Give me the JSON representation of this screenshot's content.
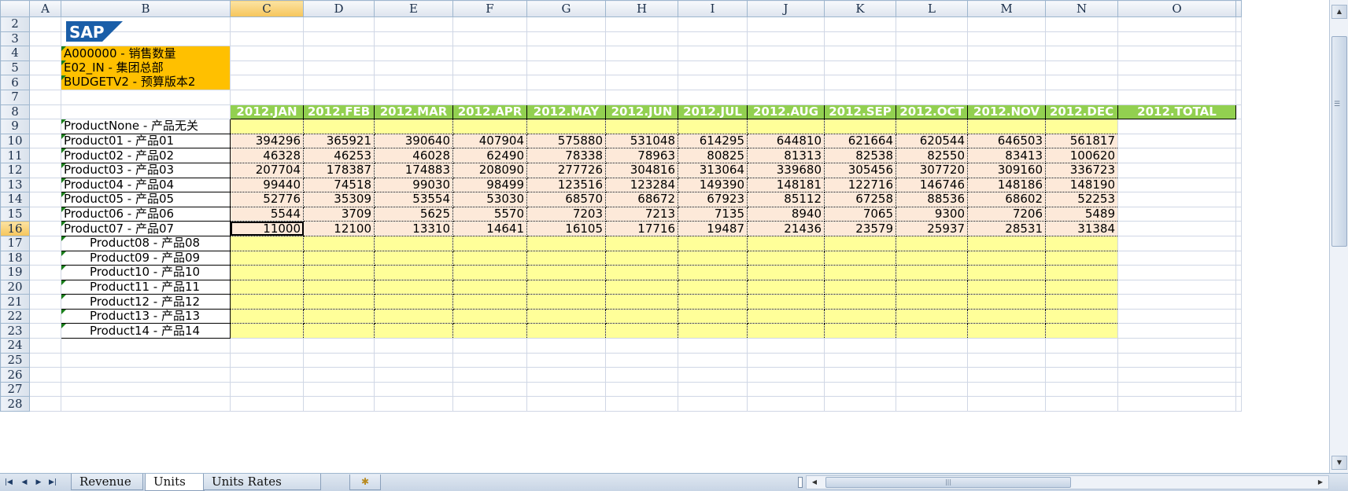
{
  "columns": [
    "A",
    "B",
    "C",
    "D",
    "E",
    "F",
    "G",
    "H",
    "I",
    "J",
    "K",
    "L",
    "M",
    "N",
    "O"
  ],
  "selected_column": "C",
  "rows": [
    2,
    3,
    4,
    5,
    6,
    7,
    8,
    9,
    10,
    11,
    12,
    13,
    14,
    15,
    16,
    17,
    18,
    19,
    20,
    21,
    22,
    23,
    24,
    25,
    26,
    27,
    28
  ],
  "selected_row": 16,
  "logo_text": "SAP",
  "info_lines": [
    "A000000 - 销售数量",
    "E02_IN - 集团总部",
    "BUDGETV2 - 预算版本2"
  ],
  "period_headers": [
    "2012.JAN",
    "2012.FEB",
    "2012.MAR",
    "2012.APR",
    "2012.MAY",
    "2012.JUN",
    "2012.JUL",
    "2012.AUG",
    "2012.SEP",
    "2012.OCT",
    "2012.NOV",
    "2012.DEC",
    "2012.TOTAL"
  ],
  "products": [
    {
      "label": "ProductNone - 产品无关",
      "values": []
    },
    {
      "label": "Product01 - 产品01",
      "values": [
        "394296",
        "365921",
        "390640",
        "407904",
        "575880",
        "531048",
        "614295",
        "644810",
        "621664",
        "620544",
        "646503",
        "561817"
      ]
    },
    {
      "label": "Product02 - 产品02",
      "values": [
        "46328",
        "46253",
        "46028",
        "62490",
        "78338",
        "78963",
        "80825",
        "81313",
        "82538",
        "82550",
        "83413",
        "100620"
      ]
    },
    {
      "label": "Product03 - 产品03",
      "values": [
        "207704",
        "178387",
        "174883",
        "208090",
        "277726",
        "304816",
        "313064",
        "339680",
        "305456",
        "307720",
        "309160",
        "336723"
      ]
    },
    {
      "label": "Product04 - 产品04",
      "values": [
        "99440",
        "74518",
        "99030",
        "98499",
        "123516",
        "123284",
        "149390",
        "148181",
        "122716",
        "146746",
        "148186",
        "148190"
      ]
    },
    {
      "label": "Product05 - 产品05",
      "values": [
        "52776",
        "35309",
        "53554",
        "53030",
        "68570",
        "68672",
        "67923",
        "85112",
        "67258",
        "88536",
        "68602",
        "52253"
      ]
    },
    {
      "label": "Product06 - 产品06",
      "values": [
        "5544",
        "3709",
        "5625",
        "5570",
        "7203",
        "7213",
        "7135",
        "8940",
        "7065",
        "9300",
        "7206",
        "5489"
      ]
    },
    {
      "label": "Product07 - 产品07",
      "values": [
        "11000",
        "12100",
        "13310",
        "14641",
        "16105",
        "17716",
        "19487",
        "21436",
        "23579",
        "25937",
        "28531",
        "31384"
      ]
    },
    {
      "label": "Product08 - 产品08",
      "values": []
    },
    {
      "label": "Product09 - 产品09",
      "values": []
    },
    {
      "label": "Product10 - 产品10",
      "values": []
    },
    {
      "label": "Product11 - 产品11",
      "values": []
    },
    {
      "label": "Product12 - 产品12",
      "values": []
    },
    {
      "label": "Product13 - 产品13",
      "values": []
    },
    {
      "label": "Product14 - 产品14",
      "values": []
    }
  ],
  "sheet_tabs": [
    {
      "label": "Revenue",
      "active": false
    },
    {
      "label": "Units",
      "active": true
    },
    {
      "label": "Units Rates",
      "active": false
    }
  ],
  "colors": {
    "header_green": "#92d050",
    "info_orange": "#ffc000",
    "data_pink": "#fde9d9",
    "input_yellow": "#ffff99",
    "sap_blue": "#1a5ea8"
  }
}
